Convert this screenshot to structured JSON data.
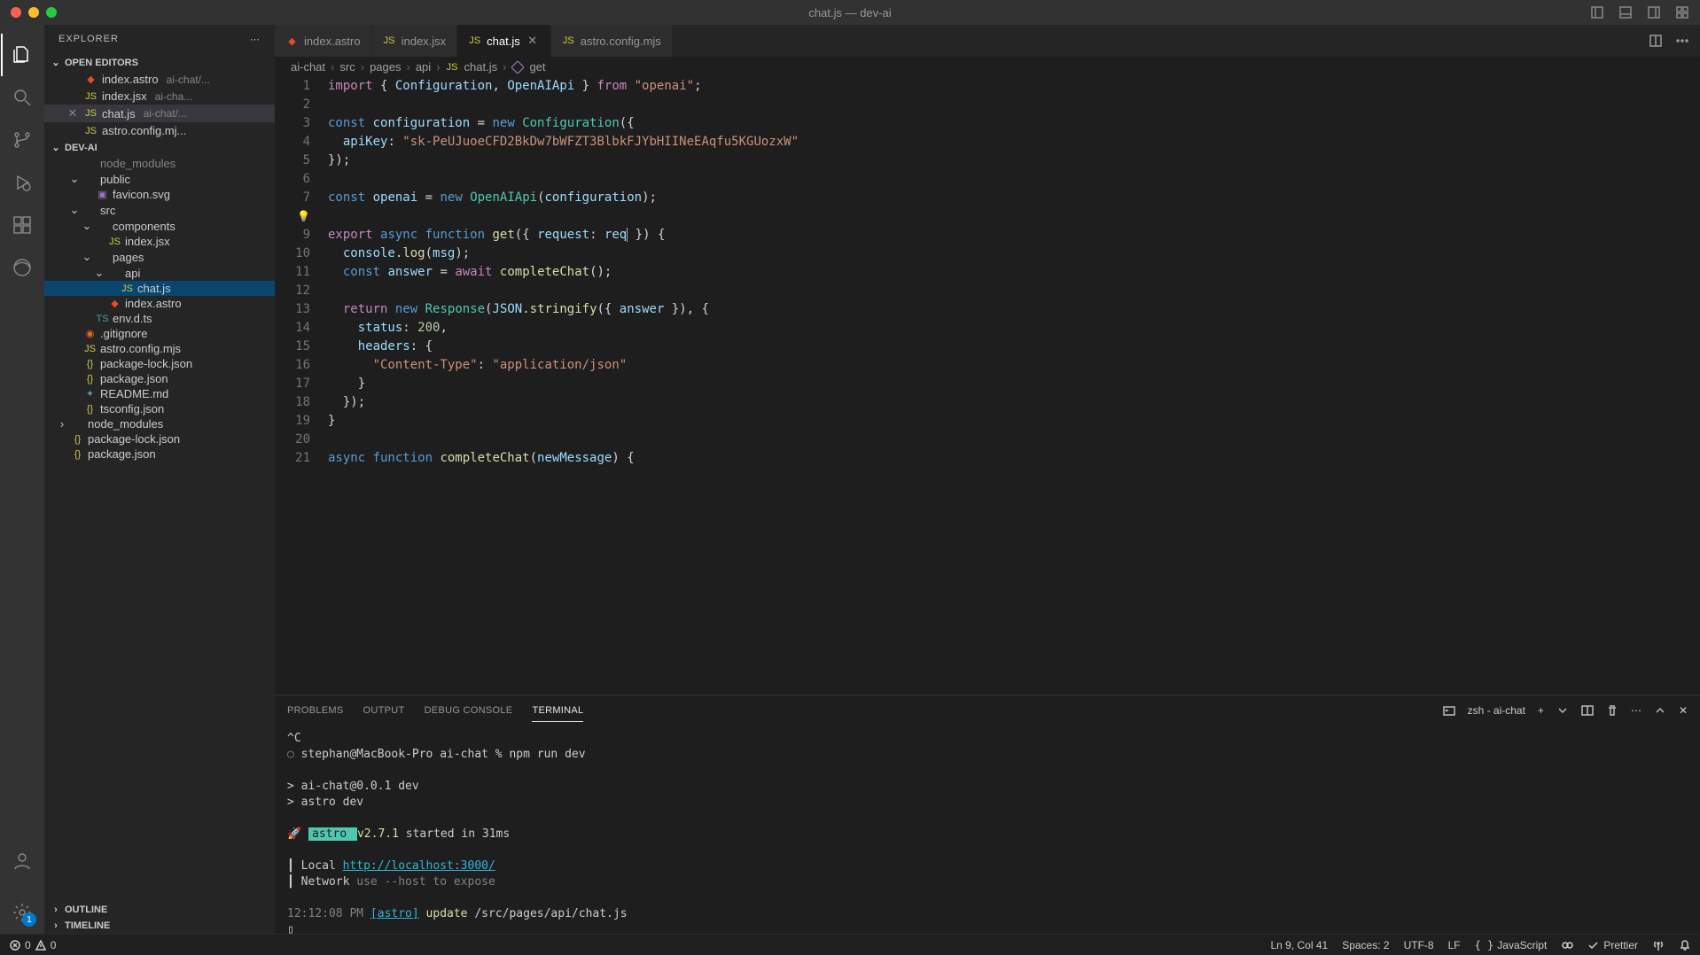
{
  "window": {
    "title": "chat.js — dev-ai"
  },
  "sidebar": {
    "header": "EXPLORER",
    "sections": {
      "open_editors": "OPEN EDITORS",
      "project": "DEV-AI",
      "outline": "OUTLINE",
      "timeline": "TIMELINE"
    },
    "open_editors_items": [
      {
        "name": "index.astro",
        "hint": "ai-chat/..."
      },
      {
        "name": "index.jsx",
        "hint": "ai-cha..."
      },
      {
        "name": "chat.js",
        "hint": "ai-chat/...",
        "closeable": true
      },
      {
        "name": "astro.config.mj...",
        "hint": ""
      }
    ],
    "tree": [
      {
        "depth": 1,
        "chev": "",
        "icon": "folder",
        "name": "node_modules",
        "dim": true
      },
      {
        "depth": 1,
        "chev": "⌄",
        "icon": "folder",
        "name": "public"
      },
      {
        "depth": 2,
        "chev": "",
        "icon": "img",
        "name": "favicon.svg"
      },
      {
        "depth": 1,
        "chev": "⌄",
        "icon": "folder",
        "name": "src"
      },
      {
        "depth": 2,
        "chev": "⌄",
        "icon": "folder",
        "name": "components"
      },
      {
        "depth": 3,
        "chev": "",
        "icon": "js",
        "name": "index.jsx"
      },
      {
        "depth": 2,
        "chev": "⌄",
        "icon": "folder",
        "name": "pages"
      },
      {
        "depth": 3,
        "chev": "⌄",
        "icon": "folder",
        "name": "api"
      },
      {
        "depth": 4,
        "chev": "",
        "icon": "js",
        "name": "chat.js",
        "selected": true
      },
      {
        "depth": 3,
        "chev": "",
        "icon": "astro",
        "name": "index.astro"
      },
      {
        "depth": 2,
        "chev": "",
        "icon": "ts",
        "name": "env.d.ts"
      },
      {
        "depth": 1,
        "chev": "",
        "icon": "git",
        "name": ".gitignore"
      },
      {
        "depth": 1,
        "chev": "",
        "icon": "js",
        "name": "astro.config.mjs"
      },
      {
        "depth": 1,
        "chev": "",
        "icon": "json",
        "name": "package-lock.json"
      },
      {
        "depth": 1,
        "chev": "",
        "icon": "json",
        "name": "package.json"
      },
      {
        "depth": 1,
        "chev": "",
        "icon": "md",
        "name": "README.md"
      },
      {
        "depth": 1,
        "chev": "",
        "icon": "json",
        "name": "tsconfig.json"
      },
      {
        "depth": 0,
        "chev": "›",
        "icon": "folder",
        "name": "node_modules"
      },
      {
        "depth": 0,
        "chev": "",
        "icon": "json",
        "name": "package-lock.json"
      },
      {
        "depth": 0,
        "chev": "",
        "icon": "json",
        "name": "package.json"
      }
    ]
  },
  "tabs": [
    {
      "icon": "astro",
      "label": "index.astro"
    },
    {
      "icon": "js",
      "label": "index.jsx"
    },
    {
      "icon": "js",
      "label": "chat.js",
      "active": true,
      "close": true
    },
    {
      "icon": "js",
      "label": "astro.config.mjs"
    }
  ],
  "breadcrumbs": [
    "ai-chat",
    "src",
    "pages",
    "api",
    "chat.js",
    "get"
  ],
  "code_lines": [
    {
      "n": 1,
      "html": "<span class='tk-kw'>import</span> { <span class='tk-var'>Configuration</span>, <span class='tk-var'>OpenAIApi</span> } <span class='tk-kw'>from</span> <span class='tk-str'>\"openai\"</span>;"
    },
    {
      "n": 2,
      "html": ""
    },
    {
      "n": 3,
      "html": "<span class='tk-decl'>const</span> <span class='tk-var'>configuration</span> = <span class='tk-decl'>new</span> <span class='tk-cls'>Configuration</span>({"
    },
    {
      "n": 4,
      "html": "  <span class='tk-var'>apiKey</span>: <span class='tk-str'>\"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\"</span>"
    },
    {
      "n": 5,
      "html": "});"
    },
    {
      "n": 6,
      "html": ""
    },
    {
      "n": 7,
      "html": "<span class='tk-decl'>const</span> <span class='tk-var'>openai</span> = <span class='tk-decl'>new</span> <span class='tk-cls'>OpenAIApi</span>(<span class='tk-var'>configuration</span>);"
    },
    {
      "n": 8,
      "hint": true,
      "html": ""
    },
    {
      "n": 9,
      "html": "<span class='tk-kw'>export</span> <span class='tk-decl'>async function</span> <span class='tk-fn'>get</span>({ <span class='tk-var'>request</span>: <span class='tk-var'>req<span class='cursor'></span></span> }) {"
    },
    {
      "n": 10,
      "html": "  <span class='tk-var'>console</span>.<span class='tk-fn'>log</span>(<span class='tk-var'>msg</span>);"
    },
    {
      "n": 11,
      "html": "  <span class='tk-decl'>const</span> <span class='tk-var'>answer</span> = <span class='tk-kw'>await</span> <span class='tk-fn'>completeChat</span>();"
    },
    {
      "n": 12,
      "html": ""
    },
    {
      "n": 13,
      "html": "  <span class='tk-kw'>return</span> <span class='tk-decl'>new</span> <span class='tk-cls'>Response</span>(<span class='tk-var'>JSON</span>.<span class='tk-fn'>stringify</span>({ <span class='tk-var'>answer</span> }), {"
    },
    {
      "n": 14,
      "html": "    <span class='tk-var'>status</span>: <span class='tk-num'>200</span>,"
    },
    {
      "n": 15,
      "html": "    <span class='tk-var'>headers</span>: {"
    },
    {
      "n": 16,
      "html": "      <span class='tk-str'>\"Content-Type\"</span>: <span class='tk-str'>\"application/json\"</span>"
    },
    {
      "n": 17,
      "html": "    }"
    },
    {
      "n": 18,
      "html": "  });"
    },
    {
      "n": 19,
      "html": "}"
    },
    {
      "n": 20,
      "html": ""
    },
    {
      "n": 21,
      "html": "<span class='tk-decl'>async function</span> <span class='tk-fn'>completeChat</span>(<span class='tk-param'>newMessage</span>) {"
    }
  ],
  "panel": {
    "tabs": {
      "problems": "PROBLEMS",
      "output": "OUTPUT",
      "debug": "DEBUG CONSOLE",
      "terminal": "TERMINAL"
    },
    "shell_label": "zsh - ai-chat",
    "terminal_lines": [
      {
        "html": "^C"
      },
      {
        "html": "<span class='term-dim'>○</span> <span class='term-prompt'>stephan@MacBook-Pro ai-chat % </span>npm run dev"
      },
      {
        "html": ""
      },
      {
        "html": "> ai-chat@0.0.1 dev"
      },
      {
        "html": "> astro dev"
      },
      {
        "html": ""
      },
      {
        "html": "  🚀 <span class='term-green-box'> astro </span> <span class='term-yellow'>v2.7.1</span> started in 31ms"
      },
      {
        "html": ""
      },
      {
        "html": "   ┃ Local    <span class='term-cyan'>http://localhost:3000/</span>"
      },
      {
        "html": "   ┃ Network  <span class='term-dim'>use --host to expose</span>"
      },
      {
        "html": ""
      },
      {
        "html": "<span class='term-dim'>12:12:08 PM</span> <span class='term-cyan'>[astro]</span> <span class='term-yellow'>update</span> /src/pages/api/chat.js"
      },
      {
        "html": "▯"
      }
    ]
  },
  "statusbar": {
    "errors": "0",
    "warnings": "0",
    "position": "Ln 9, Col 41",
    "spaces": "Spaces: 2",
    "encoding": "UTF-8",
    "eol": "LF",
    "lang": "JavaScript",
    "prettier": "Prettier"
  }
}
